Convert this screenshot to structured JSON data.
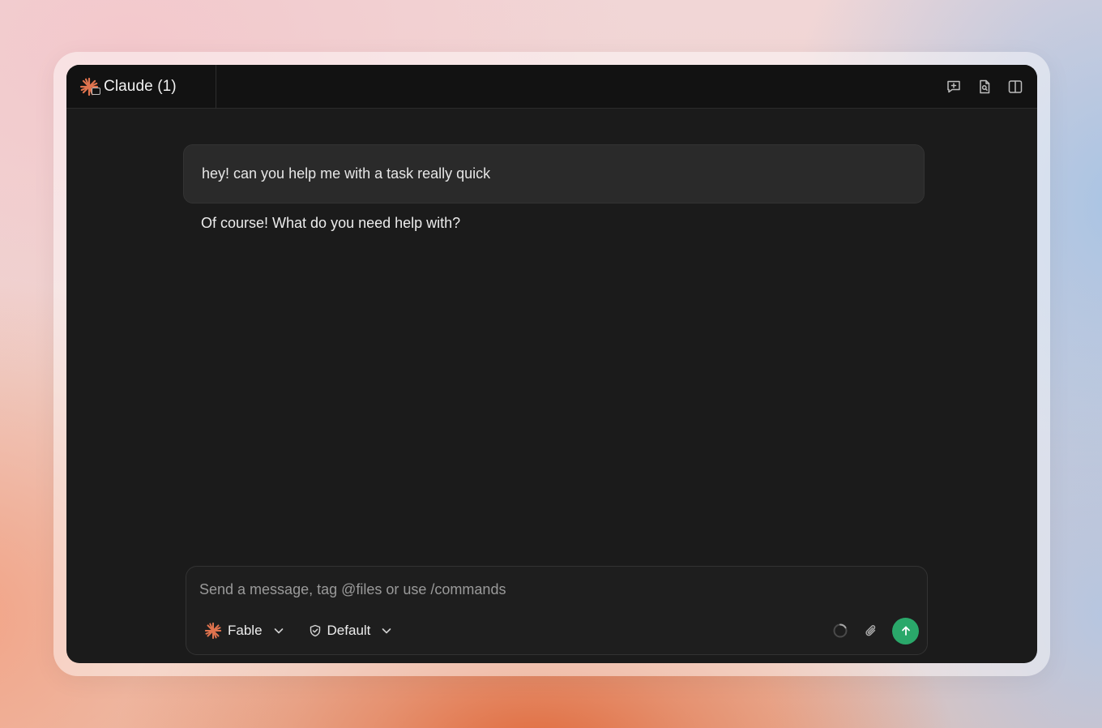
{
  "tab": {
    "title": "Claude (1)",
    "icon": "claude-sparkle-icon"
  },
  "titlebar_actions": [
    {
      "name": "new-chat-icon"
    },
    {
      "name": "file-search-icon"
    },
    {
      "name": "split-panel-icon"
    }
  ],
  "conversation": {
    "user_message": "hey! can you help me with a task really quick",
    "assistant_message": "Of course! What do you need help with?"
  },
  "composer": {
    "placeholder": "Send a message, tag @files or use /commands",
    "value": "",
    "model_label": "Fable",
    "mode_label": "Default"
  },
  "colors": {
    "accent_sparkle": "#e0734e",
    "send_button": "#2aa86a",
    "window_bg": "#1b1b1b",
    "titlebar_bg": "#121212"
  }
}
